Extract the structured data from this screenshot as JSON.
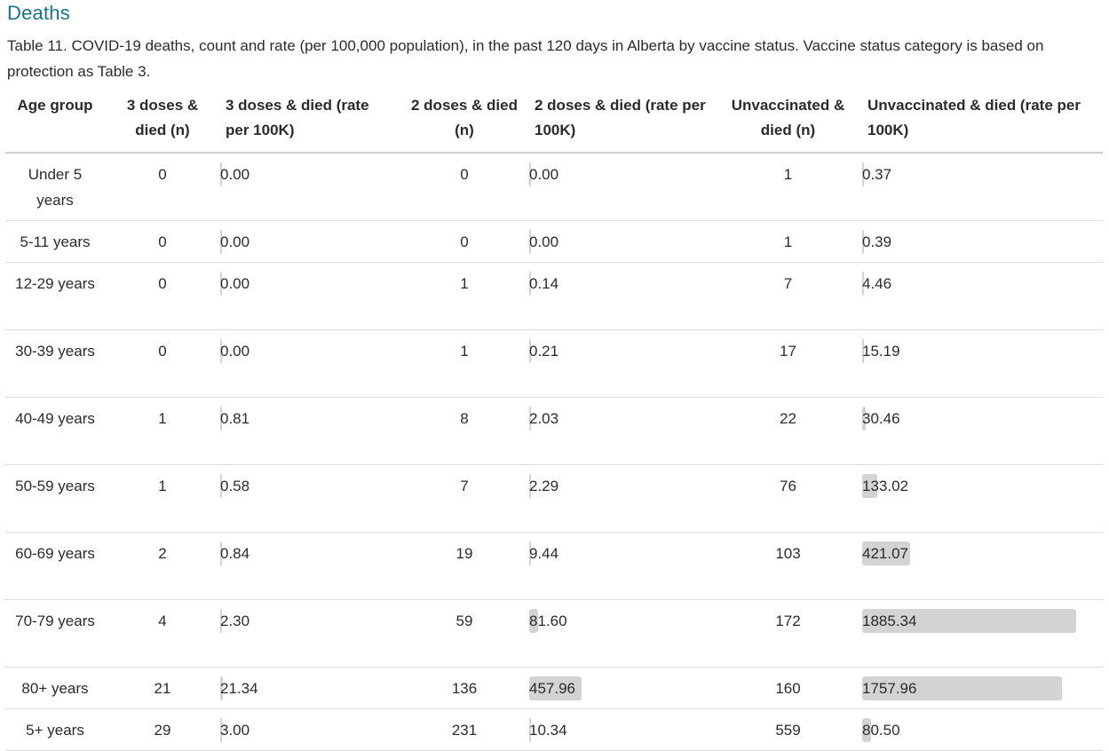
{
  "section_title": "Deaths",
  "caption": "Table 11. COVID-19 deaths, count and rate (per 100,000 population), in the past 120 days in Alberta by vaccine status. Vaccine status category is based on protection as Table 3.",
  "bar_color": "#d3d3d3",
  "title_color": "#16758c",
  "headers": {
    "age": "Age group",
    "d3_n": "3 doses & died (n)",
    "d3_rate": "3 doses & died (rate per 100K)",
    "d2_n": "2 doses & died (n)",
    "d2_rate": "2 doses & died (rate per 100K)",
    "unv_n": "Unvaccinated & died (n)",
    "unv_rate": "Unvaccinated & died (rate per 100K)"
  },
  "rows": [
    {
      "age": "Under 5 years",
      "d3_n": "0",
      "d3_rate": "0.00",
      "d2_n": "0",
      "d2_rate": "0.00",
      "unv_n": "1",
      "unv_rate": "0.37"
    },
    {
      "age": "5-11 years",
      "d3_n": "0",
      "d3_rate": "0.00",
      "d2_n": "0",
      "d2_rate": "0.00",
      "unv_n": "1",
      "unv_rate": "0.39"
    },
    {
      "age": "12-29 years",
      "d3_n": "0",
      "d3_rate": "0.00",
      "d2_n": "1",
      "d2_rate": "0.14",
      "unv_n": "7",
      "unv_rate": "4.46"
    },
    {
      "age": "30-39 years",
      "d3_n": "0",
      "d3_rate": "0.00",
      "d2_n": "1",
      "d2_rate": "0.21",
      "unv_n": "17",
      "unv_rate": "15.19"
    },
    {
      "age": "40-49 years",
      "d3_n": "1",
      "d3_rate": "0.81",
      "d2_n": "8",
      "d2_rate": "2.03",
      "unv_n": "22",
      "unv_rate": "30.46"
    },
    {
      "age": "50-59 years",
      "d3_n": "1",
      "d3_rate": "0.58",
      "d2_n": "7",
      "d2_rate": "2.29",
      "unv_n": "76",
      "unv_rate": "133.02"
    },
    {
      "age": "60-69 years",
      "d3_n": "2",
      "d3_rate": "0.84",
      "d2_n": "19",
      "d2_rate": "9.44",
      "unv_n": "103",
      "unv_rate": "421.07"
    },
    {
      "age": "70-79 years",
      "d3_n": "4",
      "d3_rate": "2.30",
      "d2_n": "59",
      "d2_rate": "81.60",
      "unv_n": "172",
      "unv_rate": "1885.34"
    },
    {
      "age": "80+ years",
      "d3_n": "21",
      "d3_rate": "21.34",
      "d2_n": "136",
      "d2_rate": "457.96",
      "unv_n": "160",
      "unv_rate": "1757.96"
    },
    {
      "age": "5+ years",
      "d3_n": "29",
      "d3_rate": "3.00",
      "d2_n": "231",
      "d2_rate": "10.34",
      "unv_n": "559",
      "unv_rate": "80.50"
    }
  ]
}
